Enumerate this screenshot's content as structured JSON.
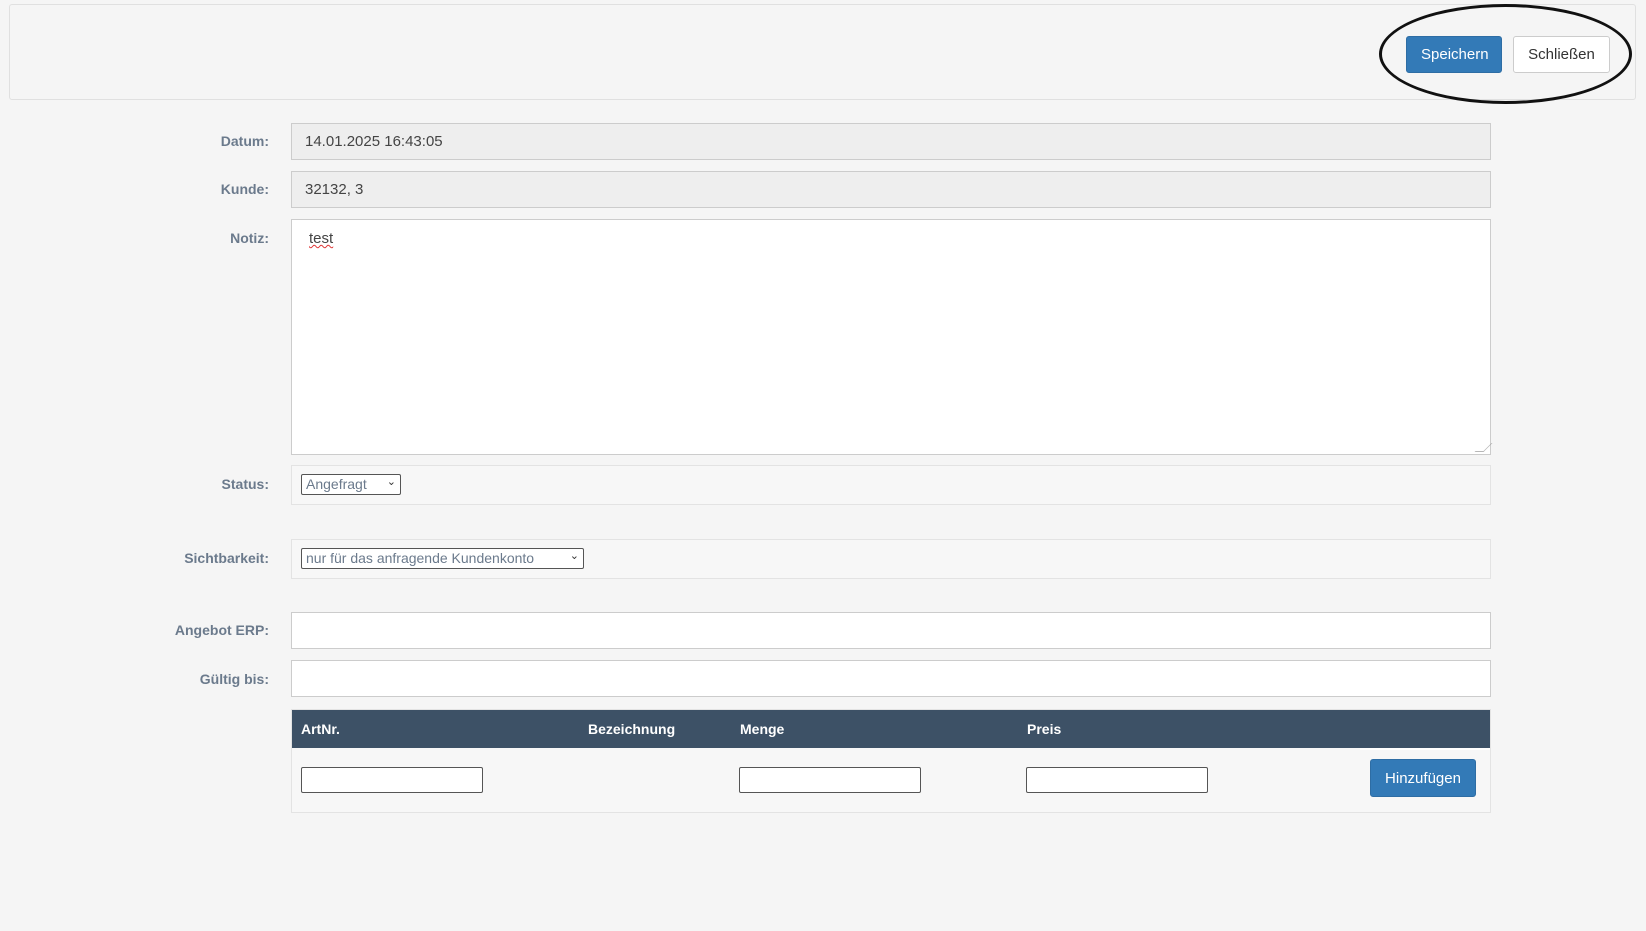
{
  "toolbar": {
    "save_label": "Speichern",
    "close_label": "Schließen"
  },
  "form": {
    "datum_label": "Datum:",
    "datum_value": "14.01.2025 16:43:05",
    "kunde_label": "Kunde:",
    "kunde_value": "32132, 3",
    "notiz_label": "Notiz:",
    "notiz_value": "test",
    "status_label": "Status:",
    "status_selected": "Angefragt",
    "sichtbarkeit_label": "Sichtbarkeit:",
    "sichtbarkeit_selected": "nur für das anfragende Kundenkonto",
    "angebot_label": "Angebot ERP:",
    "angebot_value": "",
    "gueltig_label": "Gültig bis:",
    "gueltig_value": ""
  },
  "table": {
    "headers": [
      "ArtNr.",
      "Bezeichnung",
      "Menge",
      "Preis"
    ],
    "add_label": "Hinzufügen"
  },
  "colors": {
    "primary": "#337ab7",
    "table_header": "#3d5166",
    "label": "#6b7a8c"
  },
  "icons": {
    "select_arrow": "chevron-down-icon",
    "textarea_grip": "resize-grip-icon"
  }
}
